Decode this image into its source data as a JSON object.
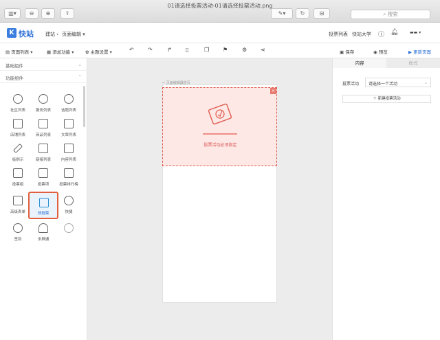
{
  "window": {
    "title": "01请选择投票活动-01请选择投票活动.png",
    "search_placeholder": "搜索"
  },
  "header": {
    "logo": "快站",
    "logo_mark": "K",
    "nav": [
      "建站",
      "页面编辑"
    ],
    "right": [
      "投票列表",
      "快站大学"
    ]
  },
  "toolbar": {
    "page_list": "页面列表",
    "add_function": "添加功能",
    "theme_settings": "主题设置",
    "save": "保存",
    "preview": "预览",
    "publish": "更新页面"
  },
  "left": {
    "section_basic": "基础组件",
    "section_function": "功能组件",
    "components": [
      "社区列表",
      "服务列表",
      "话题列表",
      "店铺列表",
      "商品列表",
      "文章列表",
      "板刷示",
      "链接列表",
      "内容列表",
      "投票组",
      "投票项",
      "投票排行榜",
      "高级表单",
      "快投票",
      "快捷",
      "签到",
      "多屏通"
    ]
  },
  "canvas": {
    "page_label": "← 页面编辑器首页",
    "vote_zone_text": "投票活动必须指定"
  },
  "right": {
    "tab_content": "内容",
    "tab_style": "样式",
    "vote_activity_label": "投票活动",
    "vote_activity_select": "请选择一个活动",
    "new_vote_button": "新建投票活动"
  },
  "colors": {
    "accent": "#2b6fd6",
    "alert": "#e05a4d",
    "highlight": "#e0603c"
  }
}
